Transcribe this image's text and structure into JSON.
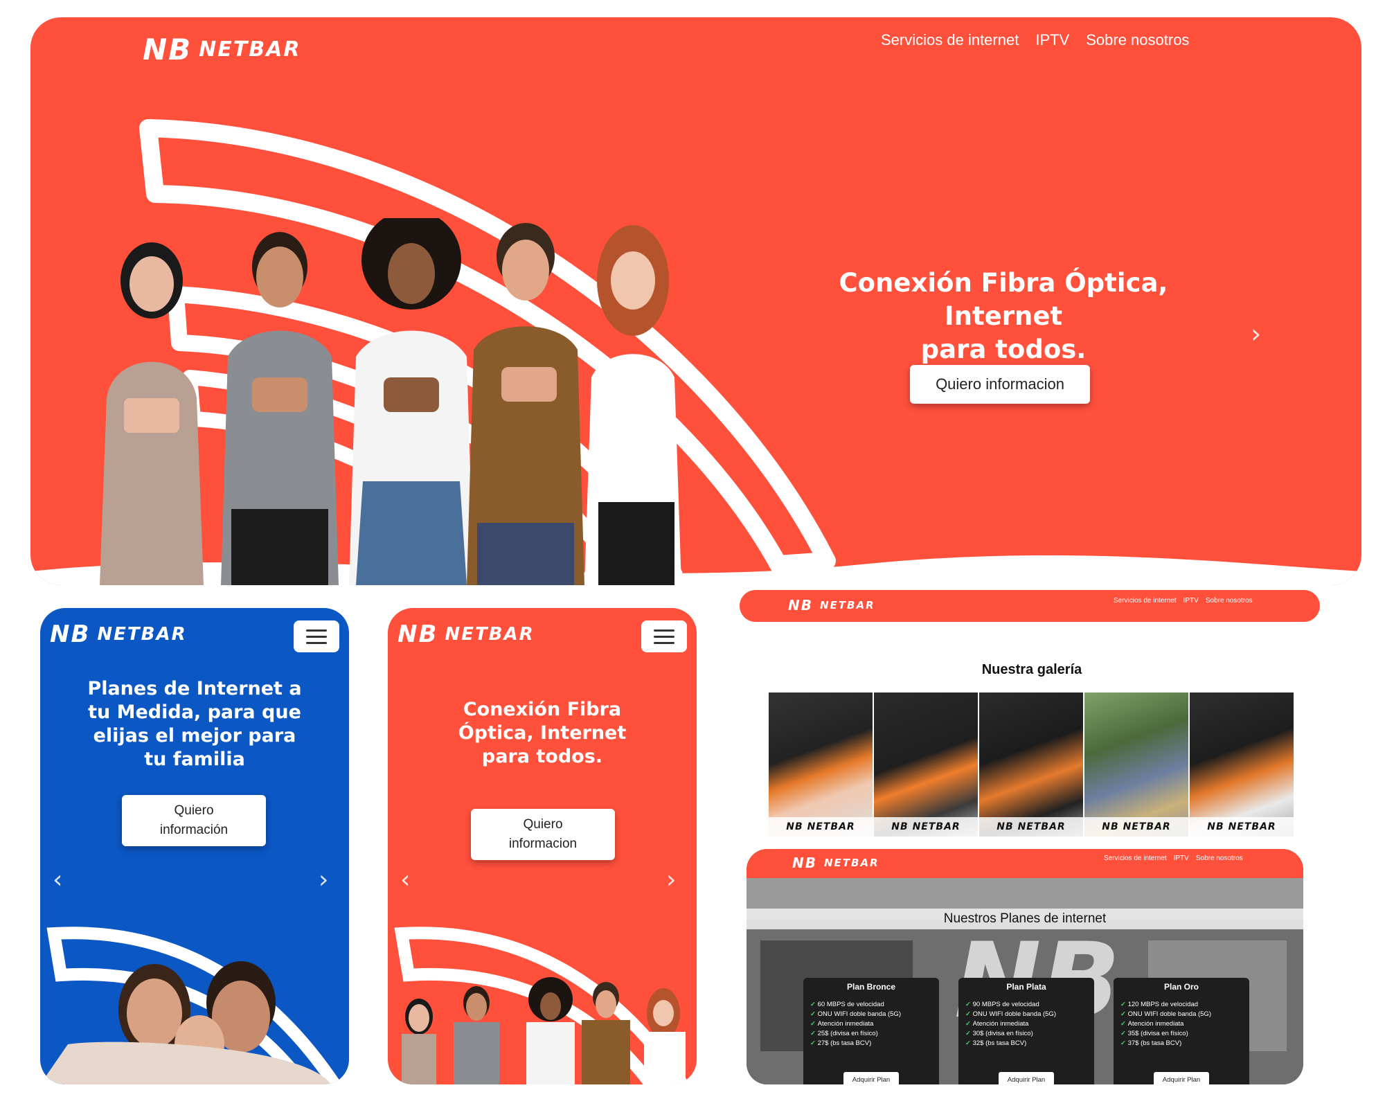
{
  "brand": {
    "mark": "NB",
    "name": "NETBAR",
    "wm_mark": "NB",
    "wm_name": "NETBAR"
  },
  "nav": {
    "item1": "Servicios de internet",
    "item2": "IPTV",
    "item3": "Sobre nosotros"
  },
  "hero": {
    "title_line1": "Conexión Fibra Óptica, Internet",
    "title_line2": "para todos.",
    "cta": "Quiero informacion"
  },
  "mobile_blue": {
    "title": "Planes de Internet a tu Medida, para que elijas el mejor para tu familia",
    "cta": "Quiero información"
  },
  "mobile_red": {
    "title": "Conexión Fibra Óptica, Internet para todos.",
    "cta": "Quiero informacion"
  },
  "gallery": {
    "title": "Nuestra galería"
  },
  "plans": {
    "title": "Nuestros Planes de internet",
    "items": [
      {
        "name": "Plan Bronce",
        "features": [
          "60 MBPS de velocidad",
          "ONU WIFI doble banda (5G)",
          "Atención inmediata",
          "25$ (divisa en físico)",
          "27$ (bs tasa BCV)"
        ],
        "button": "Adquirir Plan"
      },
      {
        "name": "Plan Plata",
        "features": [
          "90 MBPS de velocidad",
          "ONU WIFI doble banda (5G)",
          "Atención inmediata",
          "30$ (divisa en físico)",
          "32$ (bs tasa BCV)"
        ],
        "button": "Adquirir Plan"
      },
      {
        "name": "Plan Oro",
        "features": [
          "120 MBPS de velocidad",
          "ONU WIFI doble banda (5G)",
          "Atención inmediata",
          "35$ (divisa en físico)",
          "37$ (bs tasa BCV)"
        ],
        "button": "Adquirir Plan"
      }
    ]
  },
  "colors": {
    "brand_red": "#ff503c",
    "brand_blue": "#0b57c4",
    "white": "#ffffff",
    "dark": "#1e1e1e"
  },
  "icons": {
    "menu": "hamburger-icon",
    "prev": "chevron-left-icon",
    "next": "chevron-right-icon",
    "check": "check-icon"
  }
}
